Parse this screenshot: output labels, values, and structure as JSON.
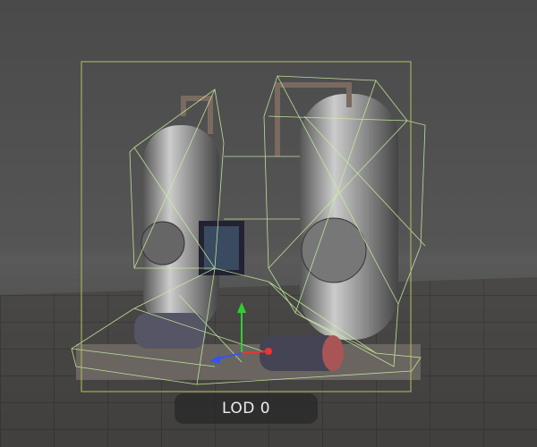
{
  "viewport": {
    "lod_label": "LOD 0",
    "colors": {
      "wireframe": "#c8f0a0",
      "bounds": "#b8c060",
      "background": "#4a4a4a"
    }
  }
}
